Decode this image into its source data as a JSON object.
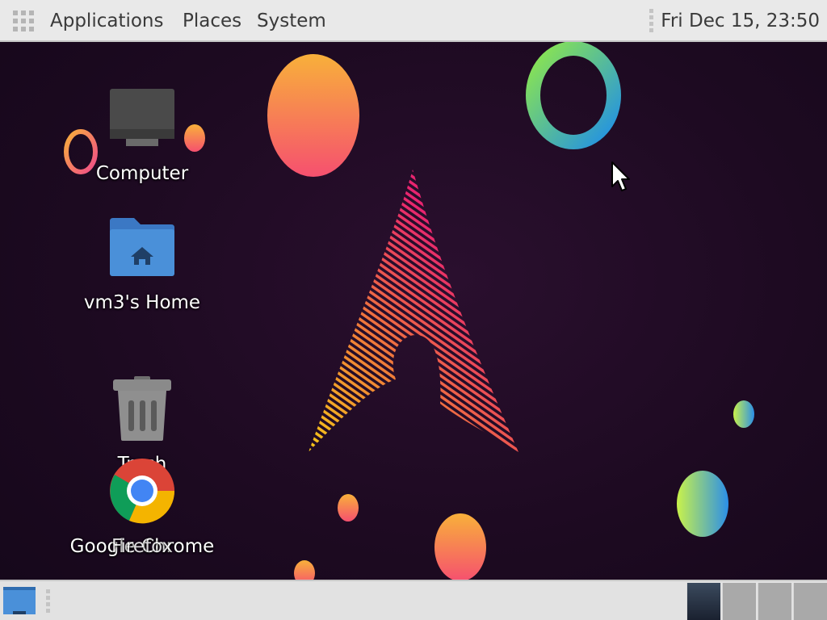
{
  "top_panel": {
    "menus": [
      "Applications",
      "Places",
      "System"
    ],
    "clock": "Fri Dec 15, 23:50",
    "app_grid_icon": "app-grid-icon"
  },
  "desktop": {
    "icons": [
      {
        "label": "Computer",
        "icon": "computer-icon"
      },
      {
        "label": "vm3's Home",
        "icon": "home-folder-icon"
      },
      {
        "label": "Trash",
        "icon": "trash-icon"
      },
      {
        "label": "Google Chrome",
        "icon": "chrome-icon"
      },
      {
        "label": "Firefox",
        "icon": "firefox-icon"
      }
    ]
  },
  "bottom_panel": {
    "show_desktop_icon": "show-desktop-icon",
    "workspaces": [
      "workspace-1",
      "workspace-2",
      "workspace-3",
      "workspace-4"
    ],
    "active_workspace": 1
  },
  "colors": {
    "panel_bg": "#e9e9e9",
    "panel_text": "#3a3a3a",
    "desktop_bg": "#1d0a21",
    "arch_pink": "#e8246f",
    "arch_yellow": "#f5c518",
    "folder_blue": "#4a90d9"
  }
}
